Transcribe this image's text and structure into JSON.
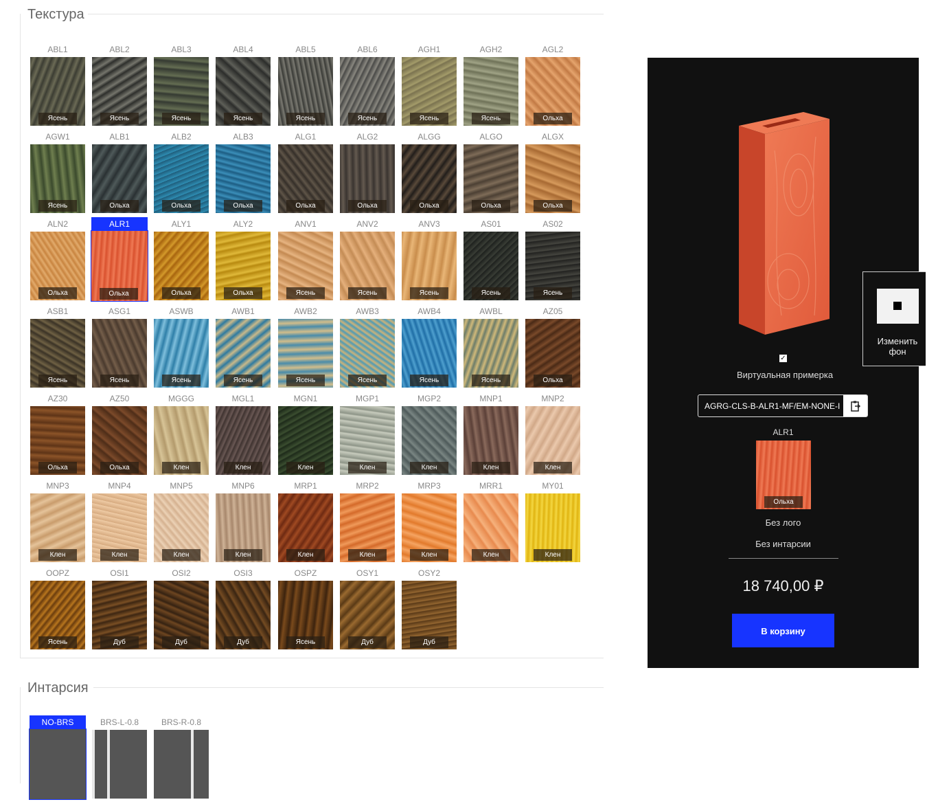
{
  "texture": {
    "title": "Текстура",
    "selected": "ALR1",
    "items": [
      {
        "code": "ABL1",
        "wood": "Ясень",
        "c1": "#3c3d33",
        "c2": "#6b6a55"
      },
      {
        "code": "ABL2",
        "wood": "Ясень",
        "c1": "#2e2f2c",
        "c2": "#75756c"
      },
      {
        "code": "ABL3",
        "wood": "Ясень",
        "c1": "#353a32",
        "c2": "#646d52"
      },
      {
        "code": "ABL4",
        "wood": "Ясень",
        "c1": "#2c2d2b",
        "c2": "#5e5f58"
      },
      {
        "code": "ABL5",
        "wood": "Ясень",
        "c1": "#3a3b37",
        "c2": "#7b7a72"
      },
      {
        "code": "ABL6",
        "wood": "Ясень",
        "c1": "#4a4a48",
        "c2": "#8a8880"
      },
      {
        "code": "AGH1",
        "wood": "Ясень",
        "c1": "#7b7350",
        "c2": "#a49c6a"
      },
      {
        "code": "AGH2",
        "wood": "Ясень",
        "c1": "#6f7258",
        "c2": "#a0a386"
      },
      {
        "code": "AGL2",
        "wood": "Ольха",
        "c1": "#c27a45",
        "c2": "#e5a46d"
      },
      {
        "code": "AGW1",
        "wood": "Ясень",
        "c1": "#3b4a2d",
        "c2": "#6f7f4f"
      },
      {
        "code": "ALB1",
        "wood": "Ольха",
        "c1": "#2a3133",
        "c2": "#4f5a5a"
      },
      {
        "code": "ALB2",
        "wood": "Ольха",
        "c1": "#1f5c7a",
        "c2": "#2f8fb5"
      },
      {
        "code": "ALB3",
        "wood": "Ольха",
        "c1": "#1d5d83",
        "c2": "#3b8fba"
      },
      {
        "code": "ALG1",
        "wood": "Ольха",
        "c1": "#352f29",
        "c2": "#5f5548"
      },
      {
        "code": "ALG2",
        "wood": "Ольха",
        "c1": "#3a3430",
        "c2": "#645a50"
      },
      {
        "code": "ALGG",
        "wood": "Ольха",
        "c1": "#221e1b",
        "c2": "#5a4a3a"
      },
      {
        "code": "ALGO",
        "wood": "Ольха",
        "c1": "#4c4034",
        "c2": "#7e6c58"
      },
      {
        "code": "ALGX",
        "wood": "Ольха",
        "c1": "#a86a33",
        "c2": "#d69a5c"
      },
      {
        "code": "ALN2",
        "wood": "Ольха",
        "c1": "#c8843f",
        "c2": "#e2ab6c"
      },
      {
        "code": "ALR1",
        "wood": "Ольха",
        "c1": "#d9512e",
        "c2": "#ef7a55"
      },
      {
        "code": "ALY1",
        "wood": "Ольха",
        "c1": "#a8650f",
        "c2": "#d49a2b"
      },
      {
        "code": "ALY2",
        "wood": "Ольха",
        "c1": "#b88a10",
        "c2": "#e0b93a"
      },
      {
        "code": "ANV1",
        "wood": "Ясень",
        "c1": "#c48a52",
        "c2": "#e6b481"
      },
      {
        "code": "ANV2",
        "wood": "Ясень",
        "c1": "#c48c55",
        "c2": "#e5b07c"
      },
      {
        "code": "ANV3",
        "wood": "Ясень",
        "c1": "#c98d4c",
        "c2": "#e9b677"
      },
      {
        "code": "AS01",
        "wood": "Ясень",
        "c1": "#1e211e",
        "c2": "#3a3e36"
      },
      {
        "code": "AS02",
        "wood": "Ясень",
        "c1": "#222220",
        "c2": "#45453f"
      },
      {
        "code": "ASB1",
        "wood": "Ясень",
        "c1": "#3b3326",
        "c2": "#6f6144"
      },
      {
        "code": "ASG1",
        "wood": "Ясень",
        "c1": "#4a3a2e",
        "c2": "#745e4a"
      },
      {
        "code": "ASWB",
        "wood": "Ясень",
        "c1": "#2f7fa8",
        "c2": "#7fbfdc"
      },
      {
        "code": "AWB1",
        "wood": "Ясень",
        "c1": "#2e7aa0",
        "c2": "#c9b98a"
      },
      {
        "code": "AWB2",
        "wood": "Ясень",
        "c1": "#4a8caa",
        "c2": "#d1bd8b"
      },
      {
        "code": "AWB3",
        "wood": "Ясень",
        "c1": "#4f9bb5",
        "c2": "#cdb279"
      },
      {
        "code": "AWB4",
        "wood": "Ясень",
        "c1": "#1f6ea6",
        "c2": "#4fa0cf"
      },
      {
        "code": "AWBL",
        "wood": "Ясень",
        "c1": "#6d7d6a",
        "c2": "#d0b97a"
      },
      {
        "code": "AZ05",
        "wood": "Ольха",
        "c1": "#4a2a16",
        "c2": "#7a4a2a"
      },
      {
        "code": "AZ30",
        "wood": "Ольха",
        "c1": "#5e3417",
        "c2": "#8c5428"
      },
      {
        "code": "AZ50",
        "wood": "Ольха",
        "c1": "#4e2d18",
        "c2": "#7c4a2a"
      },
      {
        "code": "MGGG",
        "wood": "Клен",
        "c1": "#b39a6c",
        "c2": "#d7c497"
      },
      {
        "code": "MGL1",
        "wood": "Клен",
        "c1": "#3f3330",
        "c2": "#6a5854"
      },
      {
        "code": "MGN1",
        "wood": "Клен",
        "c1": "#1e2b1a",
        "c2": "#3b4e30"
      },
      {
        "code": "MGP1",
        "wood": "Клен",
        "c1": "#8e9588",
        "c2": "#c7cbbd"
      },
      {
        "code": "MGP2",
        "wood": "Клен",
        "c1": "#4e5a5a",
        "c2": "#7a8683"
      },
      {
        "code": "MNP1",
        "wood": "Клен",
        "c1": "#5b4038",
        "c2": "#8a6a5c"
      },
      {
        "code": "MNP2",
        "wood": "Клен",
        "c1": "#d1a888",
        "c2": "#ebc9ad"
      },
      {
        "code": "MNP3",
        "wood": "Клен",
        "c1": "#c99c6c",
        "c2": "#e5c39a"
      },
      {
        "code": "MNP4",
        "wood": "Клен",
        "c1": "#d6aa7f",
        "c2": "#efcca6"
      },
      {
        "code": "MNP5",
        "wood": "Клен",
        "c1": "#d5b190",
        "c2": "#ecd2b6"
      },
      {
        "code": "MNP6",
        "wood": "Клен",
        "c1": "#a7876c",
        "c2": "#cfb397"
      },
      {
        "code": "MRP1",
        "wood": "Клен",
        "c1": "#6e2a12",
        "c2": "#a04a22"
      },
      {
        "code": "MRP2",
        "wood": "Клен",
        "c1": "#d46a2a",
        "c2": "#f09a5a"
      },
      {
        "code": "MRP3",
        "wood": "Клен",
        "c1": "#e27a2c",
        "c2": "#f5a462"
      },
      {
        "code": "MRR1",
        "wood": "Клен",
        "c1": "#e88a4e",
        "c2": "#f6b27d"
      },
      {
        "code": "MY01",
        "wood": "Клен",
        "c1": "#e0b410",
        "c2": "#f4d742"
      },
      {
        "code": "OOPZ",
        "wood": "Ясень",
        "c1": "#6b3d0e",
        "c2": "#b8761e"
      },
      {
        "code": "OSI1",
        "wood": "Дуб",
        "c1": "#3d2612",
        "c2": "#7a4f24"
      },
      {
        "code": "OSI2",
        "wood": "Дуб",
        "c1": "#352212",
        "c2": "#6d4520"
      },
      {
        "code": "OSI3",
        "wood": "Дуб",
        "c1": "#3a2512",
        "c2": "#744b22"
      },
      {
        "code": "OSPZ",
        "wood": "Ясень",
        "c1": "#3c230e",
        "c2": "#7a4a1c"
      },
      {
        "code": "OSY1",
        "wood": "Дуб",
        "c1": "#5a3a16",
        "c2": "#9a6a30"
      },
      {
        "code": "OSY2",
        "wood": "Дуб",
        "c1": "#5a3a18",
        "c2": "#946630"
      }
    ]
  },
  "inlay": {
    "title": "Интарсия",
    "selected": "NO-BRS",
    "items": [
      {
        "code": "NO-BRS"
      },
      {
        "code": "BRS-L-0.8"
      },
      {
        "code": "BRS-R-0.8"
      }
    ]
  },
  "preview": {
    "virtual_try_label": "Виртуальная примерка",
    "virtual_try_checked": "✓",
    "product_code": "AGRG-CLS-B-ALR1-MF/EM-NONE-I",
    "selected_code": "ALR1",
    "selected_wood": "Ольха",
    "logo": "Без лого",
    "inlay": "Без интарсии",
    "price": "18 740,00 ₽",
    "cart_button": "В корзину",
    "copy_icon": "clipboard-icon",
    "block_colors": {
      "front": "#e05a3a",
      "side": "#c8452a",
      "top": "#ef7a55",
      "slot": "#9a2a16"
    }
  },
  "background_widget": {
    "label_line1": "Изменить",
    "label_line2": "фон"
  },
  "colors": {
    "accent": "#1734ff",
    "panel": "#111111"
  }
}
